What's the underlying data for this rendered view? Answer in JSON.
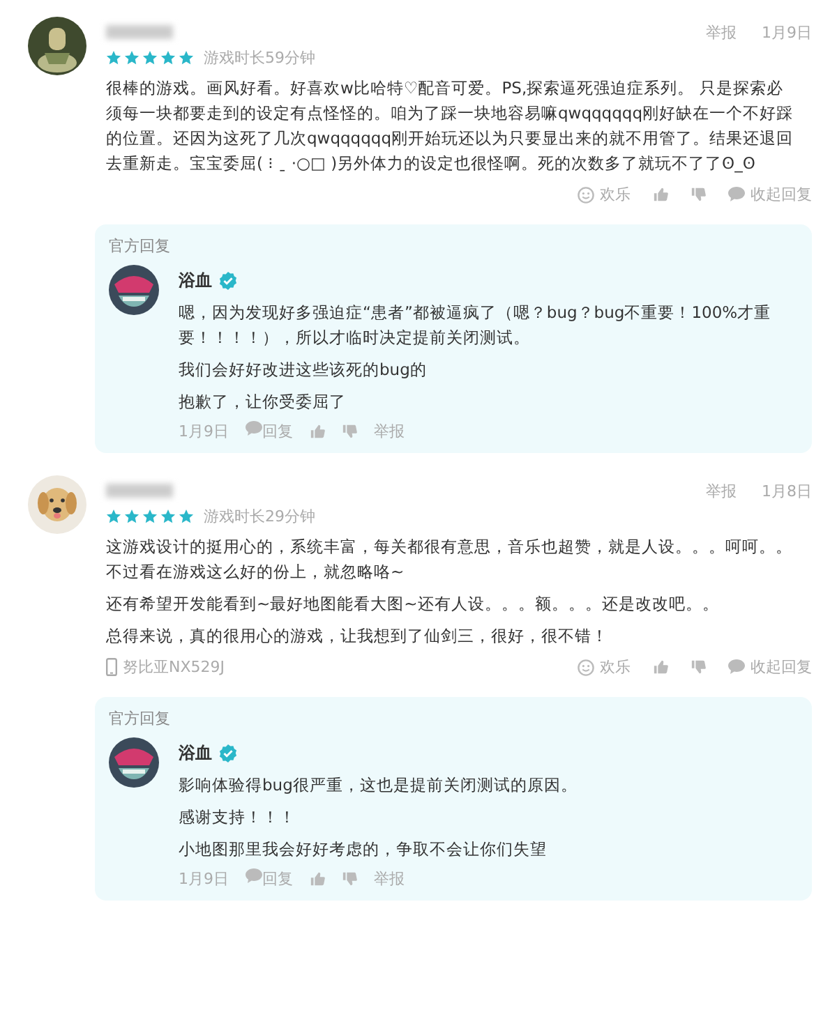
{
  "reviews": [
    {
      "stars": 5,
      "playtime": "游戏时长59分钟",
      "report": "举报",
      "date": "1月9日",
      "paragraphs": [
        "很棒的游戏。画风好看。好喜欢w比哈特♡配音可爱。PS,探索逼死强迫症系列。 只是探索必须每一块都要走到的设定有点怪怪的。咱为了踩一块地容易嘛qwqqqqqq刚好缺在一个不好踩的位置。还因为这死了几次qwqqqqqq刚开始玩还以为只要显出来的就不用管了。结果还退回去重新走。宝宝委屈( ⁝ ˍ ·○□ )另外体力的设定也很怪啊。死的次数多了就玩不了了ʘ_ʘ"
      ],
      "mood": "欢乐",
      "collapse": "收起回复",
      "reply": {
        "label": "官方回复",
        "name": "浴血",
        "verified": true,
        "paragraphs": [
          "嗯，因为发现好多强迫症“患者”都被逼疯了（嗯？bug？bug不重要！100%才重要！！！！），所以才临时决定提前关闭测试。",
          "我们会好好改进这些该死的bug的",
          "抱歉了，让你受委屈了"
        ],
        "date": "1月9日",
        "reply_action": "回复",
        "report": "举报"
      }
    },
    {
      "stars": 5,
      "playtime": "游戏时长29分钟",
      "report": "举报",
      "date": "1月8日",
      "paragraphs": [
        "这游戏设计的挺用心的，系统丰富，每关都很有意思，音乐也超赞，就是人设。。。呵呵。。不过看在游戏这么好的份上，就忽略咯~",
        "还有希望开发能看到~最好地图能看大图~还有人设。。。额。。。还是改改吧。。",
        "总得来说，真的很用心的游戏，让我想到了仙剑三，很好，很不错！"
      ],
      "device": "努比亚NX529J",
      "mood": "欢乐",
      "collapse": "收起回复",
      "reply": {
        "label": "官方回复",
        "name": "浴血",
        "verified": true,
        "paragraphs": [
          "影响体验得bug很严重，这也是提前关闭测试的原因。",
          "感谢支持！！！",
          "小地图那里我会好好考虑的，争取不会让你们失望"
        ],
        "date": "1月9日",
        "reply_action": "回复",
        "report": "举报"
      }
    }
  ]
}
